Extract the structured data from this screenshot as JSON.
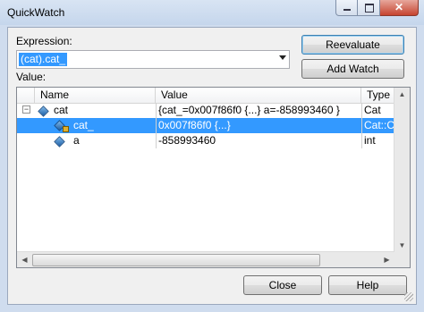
{
  "window": {
    "title": "QuickWatch"
  },
  "window_buttons": {
    "minimize": "minimize",
    "maximize": "maximize",
    "close": "close"
  },
  "expression": {
    "label": "Expression:",
    "value": "(cat).cat_"
  },
  "value_label": "Value:",
  "buttons": {
    "reevaluate": "Reevaluate",
    "add_watch": "Add Watch",
    "close": "Close",
    "help": "Help"
  },
  "grid": {
    "columns": [
      "Name",
      "Value",
      "Type"
    ],
    "rows": [
      {
        "name": "cat",
        "value": "{cat_=0x007f86f0 {...} a=-858993460 }",
        "type": "Cat",
        "expander": "−"
      },
      {
        "name": "cat_",
        "value": "0x007f86f0 {...}",
        "type": "Cat::Cat"
      },
      {
        "name": "a",
        "value": "-858993460",
        "type": "int"
      }
    ]
  }
}
